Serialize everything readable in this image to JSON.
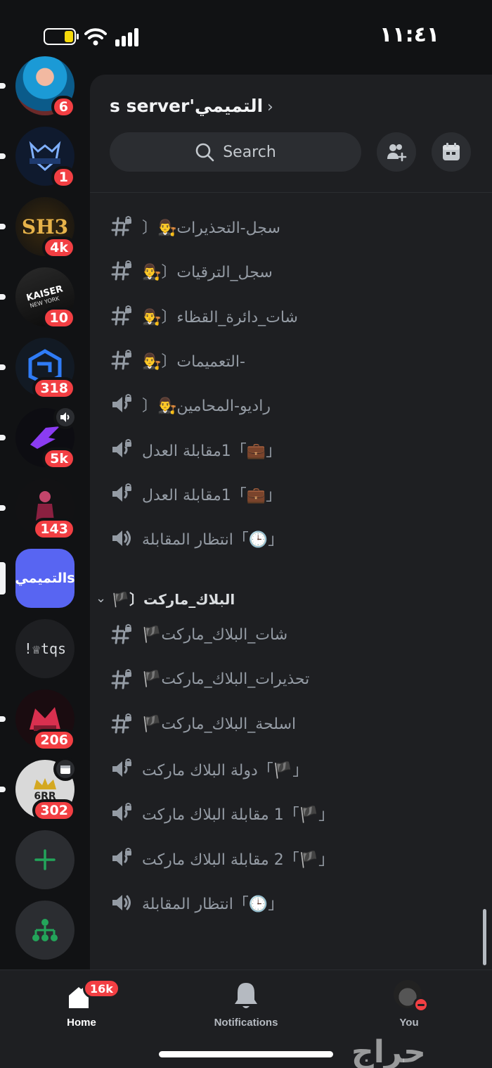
{
  "status_bar": {
    "time": "١١:٤١"
  },
  "servers": [
    {
      "name": "avatar-blue-hero",
      "badge": "6"
    },
    {
      "name": "ps-wolf",
      "badge": "1"
    },
    {
      "name": "sh3",
      "label": "SH3",
      "badge": "4k"
    },
    {
      "name": "kaiser-new-york",
      "label": "KAISER",
      "sublabel": "NEW YORK",
      "badge": "10"
    },
    {
      "name": "blue-cube",
      "badge": "318"
    },
    {
      "name": "purple-logo",
      "badge": "5k"
    },
    {
      "name": "red-character",
      "badge": "143"
    },
    {
      "name": "selected-server",
      "label": "التميميs"
    },
    {
      "name": "tqs",
      "label": "!♕tqs"
    },
    {
      "name": "red-logo",
      "badge": "206"
    },
    {
      "name": "crown-server",
      "label": "6RR",
      "badge": "302"
    }
  ],
  "server_header": {
    "title": "s server'التميمي"
  },
  "search": {
    "label": "Search"
  },
  "channels": [
    {
      "type": "text-locked",
      "name": "سجل-التحذيرات👨‍⚖️〔"
    },
    {
      "type": "text-locked",
      "name": "سجل_الترقيات〔👨‍⚖️"
    },
    {
      "type": "text-locked",
      "name": "شات_دائرة_القظاء〔👨‍⚖️"
    },
    {
      "type": "text-locked",
      "name": "-التعميمات〔👨‍⚖️"
    },
    {
      "type": "voice-locked",
      "name": "راديو-المحامين👨‍⚖️〔"
    },
    {
      "type": "voice-locked",
      "name": "「💼」1مقابلة العدل"
    },
    {
      "type": "voice-locked",
      "name": "「💼」1مقابلة العدل"
    },
    {
      "type": "voice",
      "name": "「🕒」انتظار المقابلة"
    }
  ],
  "category": {
    "name": "البلاك_ماركت〔🏴"
  },
  "category_channels": [
    {
      "type": "text-locked",
      "name": "شات_البلاك_ماركت🏴"
    },
    {
      "type": "text-locked",
      "name": "تحذيرات_البلاك_ماركت🏴"
    },
    {
      "type": "text-locked",
      "name": "اسلحة_البلاك_ماركت🏴"
    },
    {
      "type": "voice-locked",
      "name": "「🏴」دولة البلاك ماركت"
    },
    {
      "type": "voice-locked",
      "name": "「🏴」1 مقابلة البلاك ماركت"
    },
    {
      "type": "voice-locked",
      "name": "「🏴」2 مقابلة البلاك ماركت"
    },
    {
      "type": "voice",
      "name": "「🕒」انتظار المقابلة"
    }
  ],
  "bottom_nav": {
    "home": {
      "label": "Home",
      "badge": "16k"
    },
    "notifications": {
      "label": "Notifications"
    },
    "you": {
      "label": "You"
    }
  },
  "watermark": "حراج",
  "colors": {
    "accent": "#5865f2",
    "badge": "#f23f43",
    "add_green": "#23a55a"
  }
}
